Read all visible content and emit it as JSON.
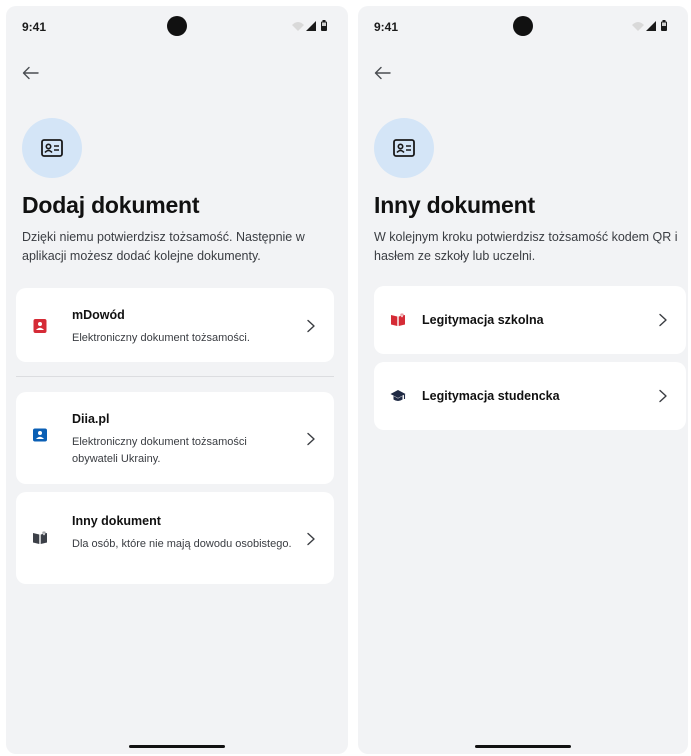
{
  "status": {
    "time": "9:41"
  },
  "left": {
    "title": "Dodaj dokument",
    "subtitle": "Dzięki niemu potwierdzisz tożsamość. Następnie w aplikacji możesz dodać kolejne dokumenty.",
    "cards": [
      {
        "title": "mDowód",
        "description": "Elektroniczny dokument tożsamości.",
        "icon": "id-badge-icon"
      },
      {
        "title": "Diia.pl",
        "description": "Elektroniczny dokument tożsamości obywateli Ukrainy.",
        "icon": "id-card-icon"
      },
      {
        "title": "Inny dokument",
        "description": "Dla osób, które nie mają dowodu osobistego.",
        "icon": "book-icon"
      }
    ]
  },
  "right": {
    "title": "Inny dokument",
    "subtitle": "W kolejnym kroku potwierdzisz tożsamość kodem QR i hasłem ze szkoły lub uczelni.",
    "cards": [
      {
        "title": "Legitymacja szkolna",
        "icon": "book-icon"
      },
      {
        "title": "Legitymacja studencka",
        "icon": "graduation-cap-icon"
      }
    ]
  },
  "colors": {
    "accent_red": "#d52b36",
    "accent_blue": "#0a5fb5",
    "icon_dark": "#3c4048",
    "circle_bg": "#d4e5f7",
    "screen_bg": "#f2f3f5"
  }
}
